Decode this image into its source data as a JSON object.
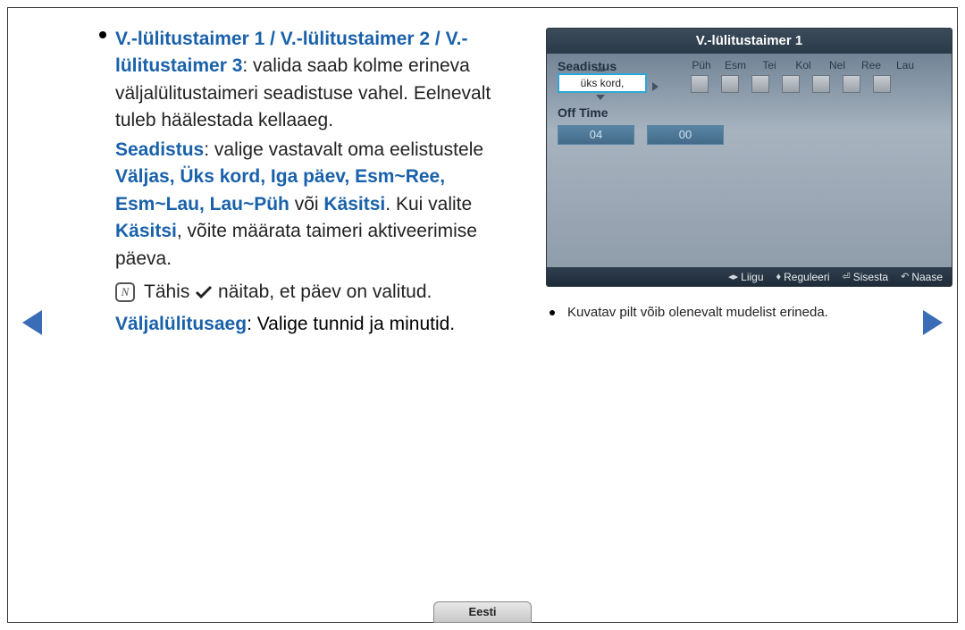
{
  "article": {
    "heading_part1": "V.-lülitustaimer 1 / V.-lülitustaimer 2 / V.-lülitustaimer 3",
    "heading_rest": ": valida saab kolme erineva väljalülitustaimeri seadistuse vahel. Eelnevalt tuleb häälestada kellaaeg.",
    "seadistus_label": "Seadistus",
    "seadistus_rest_a": ": valige vastavalt oma eelistustele ",
    "seadistus_options": "Väljas, Üks kord, Iga päev, Esm~Ree, Esm~Lau, Lau~Püh",
    "seadistus_voi": " või ",
    "seadistus_kasitsi": "Käsitsi",
    "seadistus_rest_b": ". Kui valite ",
    "seadistus_kasitsi2": "Käsitsi",
    "seadistus_rest_c": ", võite määrata taimeri aktiveerimise päeva.",
    "note_before": "Tähis ",
    "note_after": " näitab, et päev on valitud.",
    "offtime_label": "Väljalülitusaeg",
    "offtime_rest": ": Valige tunnid ja minutid."
  },
  "osd": {
    "title": "V.-lülitustaimer 1",
    "seadistus_label": "Seadistus",
    "seadistus_value": "üks kord,",
    "days": [
      "Püh",
      "Esm",
      "Tei",
      "Kol",
      "Nel",
      "Ree",
      "Lau"
    ],
    "offtime_label": "Off Time",
    "hours": "04",
    "minutes": "00",
    "footer": {
      "liigu": "Liigu",
      "reguleeri": "Reguleeri",
      "sisesta": "Sisesta",
      "naase": "Naase"
    }
  },
  "subnote": "Kuvatav pilt võib olenevalt mudelist erineda.",
  "language": "Eesti"
}
